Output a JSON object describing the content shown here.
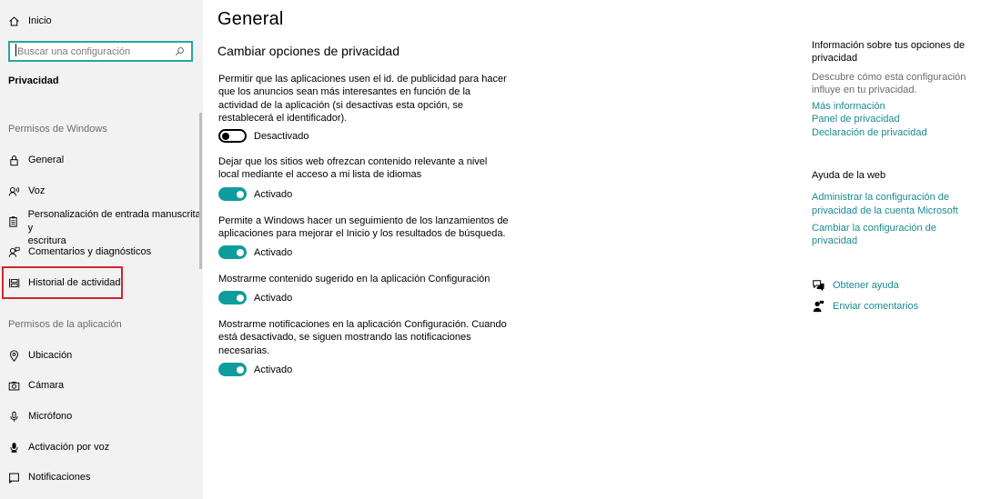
{
  "sidebar": {
    "home_label": "Inicio",
    "search_placeholder": "Buscar una configuración",
    "category": "Privacidad",
    "windows_permissions_label": "Permisos de Windows",
    "windows_items": [
      {
        "label": "General",
        "icon": "lock-icon"
      },
      {
        "label": "Voz",
        "icon": "voice-icon"
      },
      {
        "label": "Personalización de entrada manuscrita y escritura",
        "label_line1": "Personalización de entrada manuscrita y",
        "label_line2": "escritura",
        "icon": "clipboard-icon"
      },
      {
        "label": "Comentarios y diagnósticos",
        "icon": "feedback-person-icon"
      },
      {
        "label": "Historial de actividad",
        "icon": "activity-history-icon"
      }
    ],
    "app_permissions_label": "Permisos de la aplicación",
    "app_items": [
      {
        "label": "Ubicación",
        "icon": "location-icon"
      },
      {
        "label": "Cámara",
        "icon": "camera-icon"
      },
      {
        "label": "Micrófono",
        "icon": "microphone-icon"
      },
      {
        "label": "Activación por voz",
        "icon": "voice-activation-icon"
      },
      {
        "label": "Notificaciones",
        "icon": "notification-icon"
      }
    ],
    "selected_item": "Historial de actividad",
    "highlight_color": "#d1262f"
  },
  "main": {
    "title": "General",
    "subheading": "Cambiar opciones de privacidad",
    "settings": [
      {
        "description": "Permitir que las aplicaciones usen el id. de publicidad para hacer que los anuncios sean más interesantes en función de la actividad de la aplicación (si desactivas esta opción, se restablecerá el identificador).",
        "state": "Desactivado",
        "on": false
      },
      {
        "description": "Dejar que los sitios web ofrezcan contenido relevante a nivel local mediante el acceso a mi lista de idiomas",
        "state": "Activado",
        "on": true
      },
      {
        "description": "Permite a Windows hacer un seguimiento de los lanzamientos de aplicaciones para mejorar el Inicio y los resultados de búsqueda.",
        "state": "Activado",
        "on": true
      },
      {
        "description": "Mostrarme contenido sugerido en la aplicación Configuración",
        "state": "Activado",
        "on": true
      },
      {
        "description": "Mostrarme notificaciones en la aplicación Configuración. Cuando está desactivado, se siguen mostrando las notificaciones necesarias.",
        "state": "Activado",
        "on": true
      }
    ],
    "accent_color": "#0f9c9c"
  },
  "right": {
    "info_heading": "Información sobre tus opciones de privacidad",
    "info_text": "Descubre cómo esta configuración influye en tu privacidad.",
    "info_links": [
      "Más información",
      "Panel de privacidad",
      "Declaración de privacidad"
    ],
    "web_help_heading": "Ayuda de la web",
    "web_help_links": [
      "Administrar la configuración de privacidad de la cuenta Microsoft",
      "Cambiar la configuración de privacidad"
    ],
    "get_help": "Obtener ayuda",
    "send_feedback": "Enviar comentarios",
    "link_color": "#1a8a91"
  }
}
